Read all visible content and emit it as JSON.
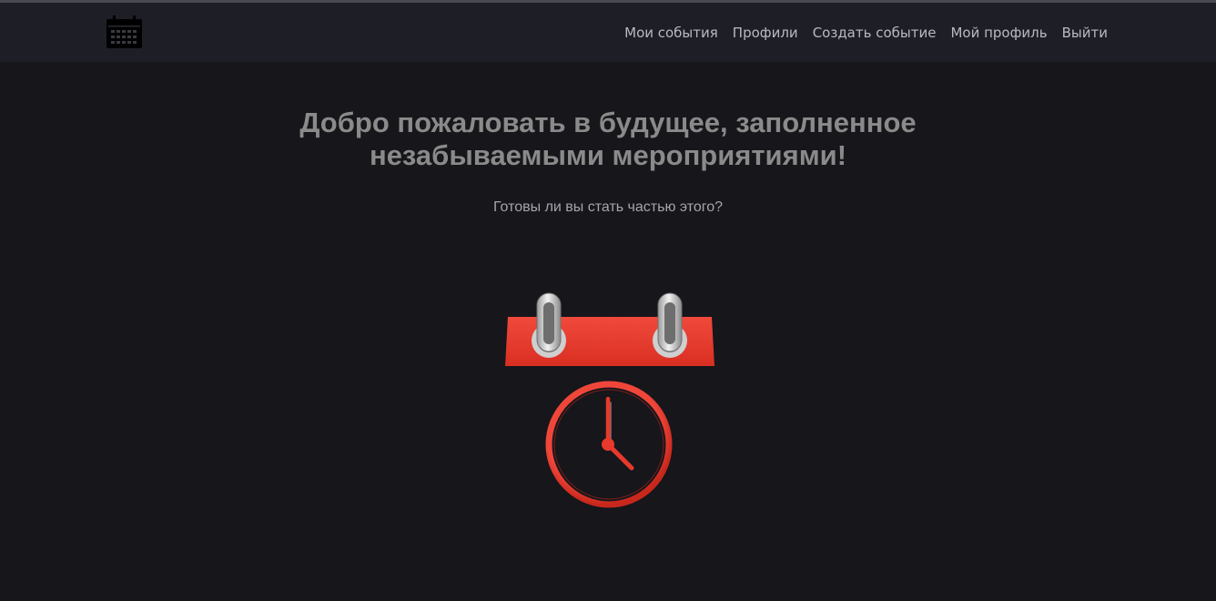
{
  "header": {
    "logo_icon": "calendar-icon",
    "nav": [
      {
        "label": "Мои события"
      },
      {
        "label": "Профили"
      },
      {
        "label": "Создать событие"
      },
      {
        "label": "Мой профиль"
      },
      {
        "label": "Выйти"
      }
    ]
  },
  "hero": {
    "title_line1": "Добро пожаловать в будущее, заполненное",
    "title_line2": "незабываемыми мероприятиями!",
    "subtitle": "Готовы ли вы стать частью этого?",
    "illustration_icon": "calendar-clock-icon"
  },
  "colors": {
    "background": "#16161b",
    "navbar": "#1e1e26",
    "accent_red": "#e8392c",
    "title": "#8a8a8a",
    "nav_text": "#b9b9c4"
  }
}
